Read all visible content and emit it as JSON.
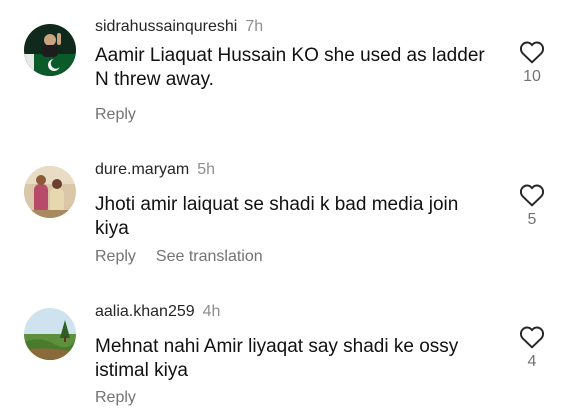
{
  "comments": [
    {
      "username": "sidrahussainqureshi",
      "time": "7h",
      "text": "Aamir Liaquat Hussain KO she used as ladder N threw away.",
      "reply_label": "Reply",
      "like_count": "10"
    },
    {
      "username": "dure.maryam",
      "time": "5h",
      "text": "Jhoti amir laiquat se shadi k bad media join kiya",
      "reply_label": "Reply",
      "translate_label": "See translation",
      "like_count": "5"
    },
    {
      "username": "aalia.khan259",
      "time": "4h",
      "text": "Mehnat nahi Amir liyaqat say shadi ke ossy istimal kiya",
      "reply_label": "Reply",
      "like_count": "4"
    }
  ],
  "icons": {
    "like": "heart-icon"
  },
  "colors": {
    "secondary_text": "#737373",
    "primary_text": "#111111"
  }
}
